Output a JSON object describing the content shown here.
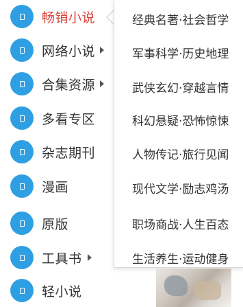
{
  "colors": {
    "icon_blue": "#2f9fe3",
    "active_text": "#d9453a",
    "text": "#333333"
  },
  "sidebar": {
    "items": [
      {
        "label": "畅销小说",
        "icon": "book-icon",
        "active": true,
        "has_submenu": false
      },
      {
        "label": "网络小说",
        "icon": "book-icon",
        "active": false,
        "has_submenu": true
      },
      {
        "label": "合集资源",
        "icon": "book-icon",
        "active": false,
        "has_submenu": true
      },
      {
        "label": "多看专区",
        "icon": "book-icon",
        "active": false,
        "has_submenu": false
      },
      {
        "label": "杂志期刊",
        "icon": "book-icon",
        "active": false,
        "has_submenu": false
      },
      {
        "label": "漫画",
        "icon": "book-icon",
        "active": false,
        "has_submenu": false
      },
      {
        "label": "原版",
        "icon": "book-icon",
        "active": false,
        "has_submenu": false
      },
      {
        "label": "工具书",
        "icon": "book-icon",
        "active": false,
        "has_submenu": true
      },
      {
        "label": "轻小说",
        "icon": "book-icon",
        "active": false,
        "has_submenu": false
      }
    ]
  },
  "submenu": {
    "items": [
      {
        "label": "经典名著·社会哲学"
      },
      {
        "label": "军事科学·历史地理"
      },
      {
        "label": "武侠玄幻·穿越言情"
      },
      {
        "label": "科幻悬疑·恐怖惊悚"
      },
      {
        "label": "人物传记·旅行见闻"
      },
      {
        "label": "现代文学·励志鸡汤"
      },
      {
        "label": "职场商战·人生百态"
      },
      {
        "label": "生活养生·运动健身"
      }
    ]
  }
}
